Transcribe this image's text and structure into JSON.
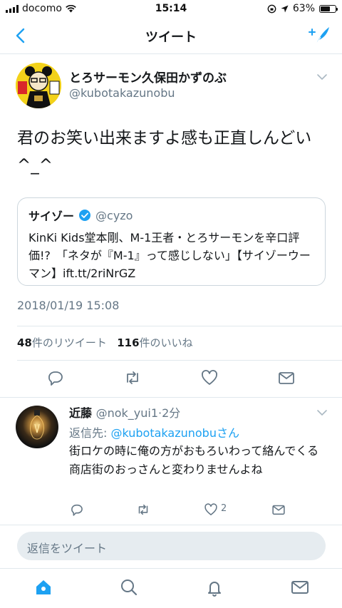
{
  "status": {
    "carrier": "docomo",
    "time": "15:14",
    "battery": "63%",
    "battery_level": 0.63
  },
  "nav": {
    "title": "ツイート"
  },
  "tweet": {
    "author_name": "とろサーモン久保田かずのぶ",
    "author_handle": "@kubotakazunobu",
    "text": "君のお笑い出来ますよ感も正直しんどい^_^",
    "quote": {
      "name": "サイゾー",
      "handle": "@cyzo",
      "text": "KinKi Kids堂本剛、M-1王者・とろサーモンを辛口評価!?　「ネタが『M-1』って感じしない」【サイゾーウーマン】ift.tt/2riNrGZ"
    },
    "timestamp": "2018/01/19 15:08",
    "retweet_count": "48",
    "retweet_label": "件のリツイート",
    "like_count": "116",
    "like_label": "件のいいね"
  },
  "reply": {
    "name": "近藤",
    "handle": "@nok_yui1",
    "time": "·2分",
    "reply_to_label": "返信先: ",
    "reply_to_handle": "@kubotakazunobuさん",
    "text": "街ロケの時に俺の方がおもろいわって絡んでくる商店街のおっさんと変わりませんよね",
    "like_count": "2"
  },
  "composer": {
    "placeholder": "返信をツイート"
  },
  "colors": {
    "accent": "#1da1f2",
    "muted": "#657786",
    "border": "#e1e8ed"
  },
  "icons": [
    "back-icon",
    "compose-icon",
    "caret-down-icon",
    "verified-icon",
    "reply-icon",
    "retweet-icon",
    "like-icon",
    "dm-icon",
    "home-icon",
    "search-icon",
    "notifications-icon",
    "messages-icon"
  ]
}
